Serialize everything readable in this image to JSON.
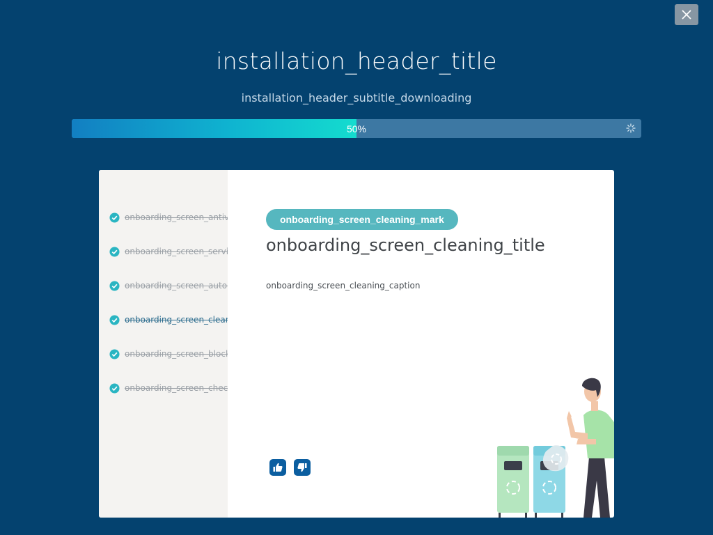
{
  "header": {
    "title": "installation_header_title",
    "subtitle": "installation_header_subtitle_downloading"
  },
  "progress": {
    "percent": 50,
    "label": "50%"
  },
  "sidebar": {
    "steps": [
      {
        "label": "onboarding_screen_antivirus_title",
        "completed": true
      },
      {
        "label": "onboarding_screen_services_title",
        "completed": true
      },
      {
        "label": "onboarding_screen_autorun_title",
        "completed": true
      },
      {
        "label": "onboarding_screen_cleaning_title",
        "completed": true,
        "active": true
      },
      {
        "label": "onboarding_screen_blocking_title",
        "completed": true
      },
      {
        "label": "onboarding_screen_checking_title",
        "completed": true
      }
    ]
  },
  "content": {
    "mark": "onboarding_screen_cleaning_mark",
    "title": "onboarding_screen_cleaning_title",
    "caption": "onboarding_screen_cleaning_caption"
  },
  "icons": {
    "close": "close-icon",
    "step_check": "check-circle-icon",
    "like": "thumbs-up-icon",
    "dislike": "thumbs-down-icon"
  },
  "colors": {
    "background": "#04426f",
    "accent": "#56b7bf",
    "progress_start": "#127fc2",
    "progress_end": "#14dccf",
    "check": "#2ab5c2"
  }
}
